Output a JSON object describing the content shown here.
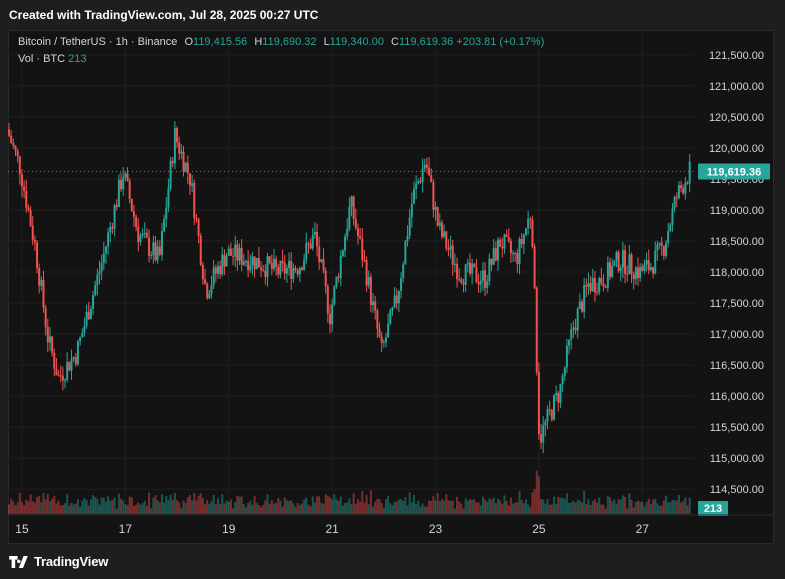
{
  "header": {
    "text": "Created with TradingView.com, Jul 28, 2025 00:27 UTC"
  },
  "legend": {
    "symbol": "Bitcoin / TetherUS · 1h · Binance",
    "open_label": "O",
    "open": "119,415.56",
    "high_label": "H",
    "high": "119,690.32",
    "low_label": "L",
    "low": "119,340.00",
    "close_label": "C",
    "close": "119,619.36",
    "change": "+203.81 (+0.17%)",
    "vol_label": "Vol · BTC",
    "vol": "213"
  },
  "footer": {
    "brand": "TradingView",
    "logo_icon": "tradingview-logo-icon"
  },
  "colors": {
    "up": "#26a69a",
    "down": "#ef5350",
    "price_tag": "#26a69a",
    "background": "#131313",
    "text": "#d1d4dc"
  },
  "chart_data": {
    "type": "candlestick",
    "y_ticks": [
      "121,500.00",
      "121,000.00",
      "120,500.00",
      "120,000.00",
      "119,500.00",
      "119,000.00",
      "118,500.00",
      "118,000.00",
      "117,500.00",
      "117,000.00",
      "116,500.00",
      "116,000.00",
      "115,500.00",
      "115,000.00",
      "114,500.00"
    ],
    "y_tick_values": [
      121500,
      121000,
      120500,
      120000,
      119500,
      119000,
      118500,
      118000,
      117500,
      117000,
      116500,
      116000,
      115500,
      115000,
      114500
    ],
    "ylim": [
      114100,
      121900
    ],
    "x_ticks": [
      "15",
      "17",
      "19",
      "21",
      "23",
      "25",
      "27"
    ],
    "x_tick_days": [
      15,
      17,
      19,
      21,
      23,
      25,
      27
    ],
    "xlim": [
      14.73,
      28.0
    ],
    "last_price": "119,619.36",
    "last_price_value": 119619.36,
    "last_volume": "213",
    "path_days": [
      14.75,
      15.0,
      15.3,
      15.55,
      15.75,
      16.1,
      16.6,
      17.0,
      17.3,
      17.7,
      18.0,
      18.3,
      18.6,
      19.0,
      19.5,
      20.0,
      20.4,
      20.7,
      21.0,
      21.4,
      21.7,
      22.0,
      22.3,
      22.6,
      22.85,
      23.1,
      23.5,
      24.0,
      24.3,
      24.6,
      24.9,
      25.05,
      25.25,
      25.45,
      25.7,
      26.0,
      26.3,
      26.6,
      27.0,
      27.2,
      27.45,
      27.7,
      27.95
    ],
    "path_prices": [
      120300,
      119700,
      118400,
      116900,
      116300,
      116700,
      118200,
      119600,
      118600,
      118200,
      120200,
      119500,
      117700,
      118300,
      118200,
      118000,
      118100,
      118600,
      117300,
      119100,
      118000,
      116700,
      117600,
      119200,
      119800,
      118700,
      118000,
      117900,
      118500,
      118200,
      119000,
      115300,
      115700,
      116100,
      117100,
      117800,
      117900,
      118200,
      118000,
      118100,
      118400,
      119200,
      119620
    ],
    "volume_scale": [
      0,
      1.2
    ]
  }
}
